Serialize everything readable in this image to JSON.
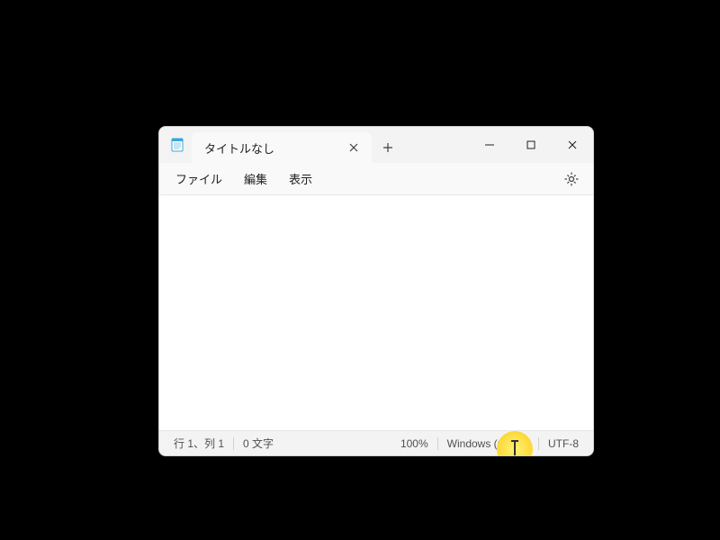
{
  "tab": {
    "title": "タイトルなし"
  },
  "menu": {
    "file": "ファイル",
    "edit": "編集",
    "view": "表示"
  },
  "status": {
    "position": "行 1、列 1",
    "chars": "0 文字",
    "zoom": "100%",
    "line_ending": "Windows (CRLF)",
    "encoding": "UTF-8"
  },
  "editor": {
    "content": ""
  }
}
